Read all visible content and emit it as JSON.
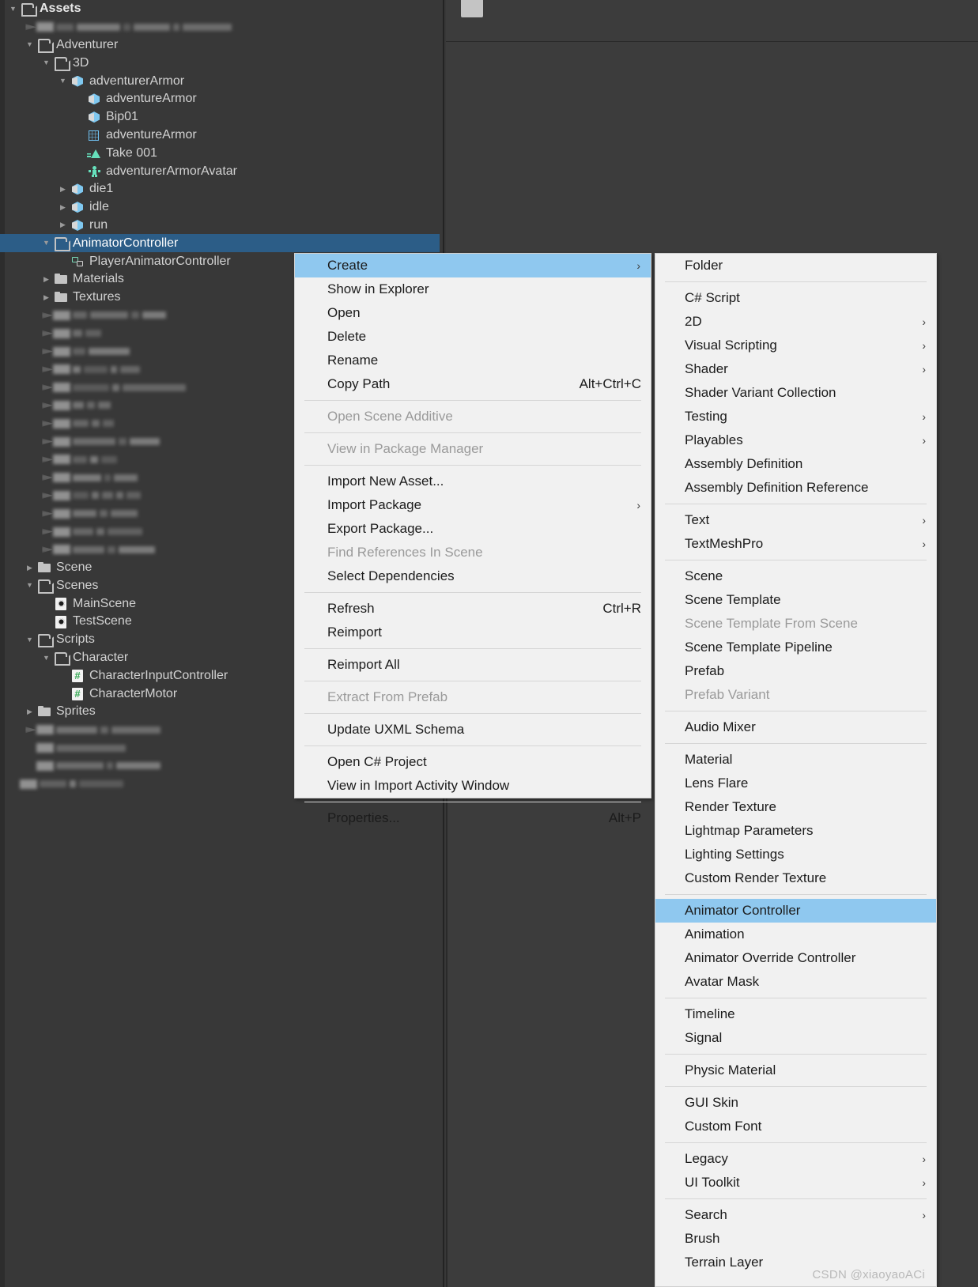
{
  "project_panel": {
    "tree": [
      {
        "label": "Assets",
        "indent": 0,
        "twisty": "open",
        "icon": "folder-open",
        "bold": true,
        "selected": false
      },
      {
        "label": "",
        "indent": 1,
        "twisty": "blur",
        "icon": "blur",
        "blur": true,
        "widths": [
          22,
          55,
          9,
          46,
          8,
          62
        ]
      },
      {
        "label": "Adventurer",
        "indent": 1,
        "twisty": "open",
        "icon": "folder-open",
        "selected": false
      },
      {
        "label": "3D",
        "indent": 2,
        "twisty": "open",
        "icon": "folder-open",
        "selected": false
      },
      {
        "label": "adventurerArmor",
        "indent": 3,
        "twisty": "open",
        "icon": "cube",
        "selected": false
      },
      {
        "label": "adventureArmor",
        "indent": 4,
        "twisty": "none",
        "icon": "cube",
        "selected": false
      },
      {
        "label": "Bip01",
        "indent": 4,
        "twisty": "none",
        "icon": "cube",
        "selected": false
      },
      {
        "label": "adventureArmor",
        "indent": 4,
        "twisty": "none",
        "icon": "mesh",
        "selected": false
      },
      {
        "label": "Take 001",
        "indent": 4,
        "twisty": "none",
        "icon": "clip",
        "selected": false
      },
      {
        "label": "adventurerArmorAvatar",
        "indent": 4,
        "twisty": "none",
        "icon": "avatar",
        "selected": false
      },
      {
        "label": "die1",
        "indent": 3,
        "twisty": "closed",
        "icon": "cube",
        "selected": false
      },
      {
        "label": "idle",
        "indent": 3,
        "twisty": "closed",
        "icon": "cube",
        "selected": false
      },
      {
        "label": "run",
        "indent": 3,
        "twisty": "closed",
        "icon": "cube",
        "selected": false
      },
      {
        "label": "AnimatorController",
        "indent": 2,
        "twisty": "open",
        "icon": "folder-open",
        "selected": true
      },
      {
        "label": "PlayerAnimatorController",
        "indent": 3,
        "twisty": "none",
        "icon": "anictrl",
        "selected": false
      },
      {
        "label": "Materials",
        "indent": 2,
        "twisty": "closed",
        "icon": "folder",
        "selected": false
      },
      {
        "label": "Textures",
        "indent": 2,
        "twisty": "closed",
        "icon": "folder",
        "selected": false
      },
      {
        "label": "",
        "indent": 2,
        "twisty": "blur",
        "icon": "blur",
        "blur": true,
        "widths": [
          18,
          48,
          10,
          30
        ]
      },
      {
        "label": "",
        "indent": 2,
        "twisty": "blur",
        "icon": "blur",
        "blur": true,
        "widths": [
          12,
          20
        ]
      },
      {
        "label": "",
        "indent": 2,
        "twisty": "blur",
        "icon": "blur",
        "blur": true,
        "widths": [
          16,
          52
        ]
      },
      {
        "label": "",
        "indent": 2,
        "twisty": "blur",
        "icon": "blur",
        "blur": true,
        "widths": [
          10,
          30,
          8,
          25
        ]
      },
      {
        "label": "",
        "indent": 2,
        "twisty": "blur",
        "icon": "blur",
        "blur": true,
        "widths": [
          46,
          9,
          80
        ]
      },
      {
        "label": "",
        "indent": 2,
        "twisty": "blur",
        "icon": "blur",
        "blur": true,
        "widths": [
          14,
          10,
          16
        ]
      },
      {
        "label": "",
        "indent": 2,
        "twisty": "blur",
        "icon": "blur",
        "blur": true,
        "widths": [
          20,
          10,
          14
        ]
      },
      {
        "label": "",
        "indent": 2,
        "twisty": "blur",
        "icon": "blur",
        "blur": true,
        "widths": [
          54,
          10,
          38
        ]
      },
      {
        "label": "",
        "indent": 2,
        "twisty": "blur",
        "icon": "blur",
        "blur": true,
        "widths": [
          18,
          10,
          20
        ]
      },
      {
        "label": "",
        "indent": 2,
        "twisty": "blur",
        "icon": "blur",
        "blur": true,
        "widths": [
          36,
          8,
          30
        ]
      },
      {
        "label": "",
        "indent": 2,
        "twisty": "blur",
        "icon": "blur",
        "blur": true,
        "widths": [
          20,
          9,
          14,
          9,
          18
        ]
      },
      {
        "label": "",
        "indent": 2,
        "twisty": "blur",
        "icon": "blur",
        "blur": true,
        "widths": [
          30,
          10,
          34
        ]
      },
      {
        "label": "",
        "indent": 2,
        "twisty": "blur",
        "icon": "blur",
        "blur": true,
        "widths": [
          26,
          10,
          44
        ]
      },
      {
        "label": "",
        "indent": 2,
        "twisty": "blur",
        "icon": "blur",
        "blur": true,
        "widths": [
          40,
          10,
          46
        ]
      },
      {
        "label": "Scene",
        "indent": 1,
        "twisty": "closed",
        "icon": "folder",
        "selected": false
      },
      {
        "label": "Scenes",
        "indent": 1,
        "twisty": "open",
        "icon": "folder-open",
        "selected": false
      },
      {
        "label": "MainScene",
        "indent": 2,
        "twisty": "none",
        "icon": "scene",
        "selected": false
      },
      {
        "label": "TestScene",
        "indent": 2,
        "twisty": "none",
        "icon": "scene",
        "selected": false
      },
      {
        "label": "Scripts",
        "indent": 1,
        "twisty": "open",
        "icon": "folder-open",
        "selected": false
      },
      {
        "label": "Character",
        "indent": 2,
        "twisty": "open",
        "icon": "folder-open",
        "selected": false
      },
      {
        "label": "CharacterInputController",
        "indent": 3,
        "twisty": "none",
        "icon": "cs",
        "selected": false
      },
      {
        "label": "CharacterMotor",
        "indent": 3,
        "twisty": "none",
        "icon": "cs",
        "selected": false
      },
      {
        "label": "Sprites",
        "indent": 1,
        "twisty": "closed",
        "icon": "folder",
        "selected": false
      },
      {
        "label": "",
        "indent": 1,
        "twisty": "blur",
        "icon": "blur",
        "blur": true,
        "widths": [
          52,
          10,
          62
        ]
      },
      {
        "label": "",
        "indent": 1,
        "twisty": "blurnone",
        "icon": "blur",
        "blur": true,
        "widths": [
          88
        ]
      },
      {
        "label": "",
        "indent": 1,
        "twisty": "blurnone",
        "icon": "blur",
        "blur": true,
        "widths": [
          60,
          8,
          56
        ]
      },
      {
        "label": "",
        "indent": 0,
        "twisty": "blurnone",
        "icon": "blur",
        "blur": true,
        "widths": [
          34,
          8,
          56
        ]
      }
    ]
  },
  "right_pane": {
    "clipped_header": "",
    "preview_thumb": "preview-thumbnail"
  },
  "context_menu": {
    "items": [
      {
        "label": "Create",
        "submenu": true,
        "highlight": true
      },
      {
        "label": "Show in Explorer"
      },
      {
        "label": "Open"
      },
      {
        "label": "Delete"
      },
      {
        "label": "Rename"
      },
      {
        "label": "Copy Path",
        "shortcut": "Alt+Ctrl+C"
      },
      {
        "separator": true
      },
      {
        "label": "Open Scene Additive",
        "disabled": true
      },
      {
        "separator": true
      },
      {
        "label": "View in Package Manager",
        "disabled": true
      },
      {
        "separator": true
      },
      {
        "label": "Import New Asset..."
      },
      {
        "label": "Import Package",
        "submenu": true
      },
      {
        "label": "Export Package..."
      },
      {
        "label": "Find References In Scene",
        "disabled": true
      },
      {
        "label": "Select Dependencies"
      },
      {
        "separator": true
      },
      {
        "label": "Refresh",
        "shortcut": "Ctrl+R"
      },
      {
        "label": "Reimport"
      },
      {
        "separator": true
      },
      {
        "label": "Reimport All"
      },
      {
        "separator": true
      },
      {
        "label": "Extract From Prefab",
        "disabled": true
      },
      {
        "separator": true
      },
      {
        "label": "Update UXML Schema"
      },
      {
        "separator": true
      },
      {
        "label": "Open C# Project"
      },
      {
        "label": "View in Import Activity Window"
      },
      {
        "separator": true
      },
      {
        "label": "Properties...",
        "shortcut": "Alt+P"
      }
    ]
  },
  "create_submenu": {
    "items": [
      {
        "label": "Folder"
      },
      {
        "separator": true
      },
      {
        "label": "C# Script"
      },
      {
        "label": "2D",
        "submenu": true
      },
      {
        "label": "Visual Scripting",
        "submenu": true
      },
      {
        "label": "Shader",
        "submenu": true
      },
      {
        "label": "Shader Variant Collection"
      },
      {
        "label": "Testing",
        "submenu": true
      },
      {
        "label": "Playables",
        "submenu": true
      },
      {
        "label": "Assembly Definition"
      },
      {
        "label": "Assembly Definition Reference"
      },
      {
        "separator": true
      },
      {
        "label": "Text",
        "submenu": true
      },
      {
        "label": "TextMeshPro",
        "submenu": true
      },
      {
        "separator": true
      },
      {
        "label": "Scene"
      },
      {
        "label": "Scene Template"
      },
      {
        "label": "Scene Template From Scene",
        "disabled": true
      },
      {
        "label": "Scene Template Pipeline"
      },
      {
        "label": "Prefab"
      },
      {
        "label": "Prefab Variant",
        "disabled": true
      },
      {
        "separator": true
      },
      {
        "label": "Audio Mixer"
      },
      {
        "separator": true
      },
      {
        "label": "Material"
      },
      {
        "label": "Lens Flare"
      },
      {
        "label": "Render Texture"
      },
      {
        "label": "Lightmap Parameters"
      },
      {
        "label": "Lighting Settings"
      },
      {
        "label": "Custom Render Texture"
      },
      {
        "separator": true
      },
      {
        "label": "Animator Controller",
        "highlight": true
      },
      {
        "label": "Animation"
      },
      {
        "label": "Animator Override Controller"
      },
      {
        "label": "Avatar Mask"
      },
      {
        "separator": true
      },
      {
        "label": "Timeline"
      },
      {
        "label": "Signal"
      },
      {
        "separator": true
      },
      {
        "label": "Physic Material"
      },
      {
        "separator": true
      },
      {
        "label": "GUI Skin"
      },
      {
        "label": "Custom Font"
      },
      {
        "separator": true
      },
      {
        "label": "Legacy",
        "submenu": true
      },
      {
        "label": "UI Toolkit",
        "submenu": true
      },
      {
        "separator": true
      },
      {
        "label": "Search",
        "submenu": true
      },
      {
        "label": "Brush"
      },
      {
        "label": "Terrain Layer"
      }
    ]
  },
  "watermark": {
    "text": "CSDN @xiaoyaoACi"
  },
  "colors": {
    "panel_bg": "#383838",
    "row_selected": "#2c5d87",
    "menu_bg": "#f1f1f1",
    "menu_highlight": "#8fc8ef",
    "text_light": "#d2d2d2",
    "text_dark": "#1b1b1b",
    "text_disabled": "#9a9a9a"
  }
}
